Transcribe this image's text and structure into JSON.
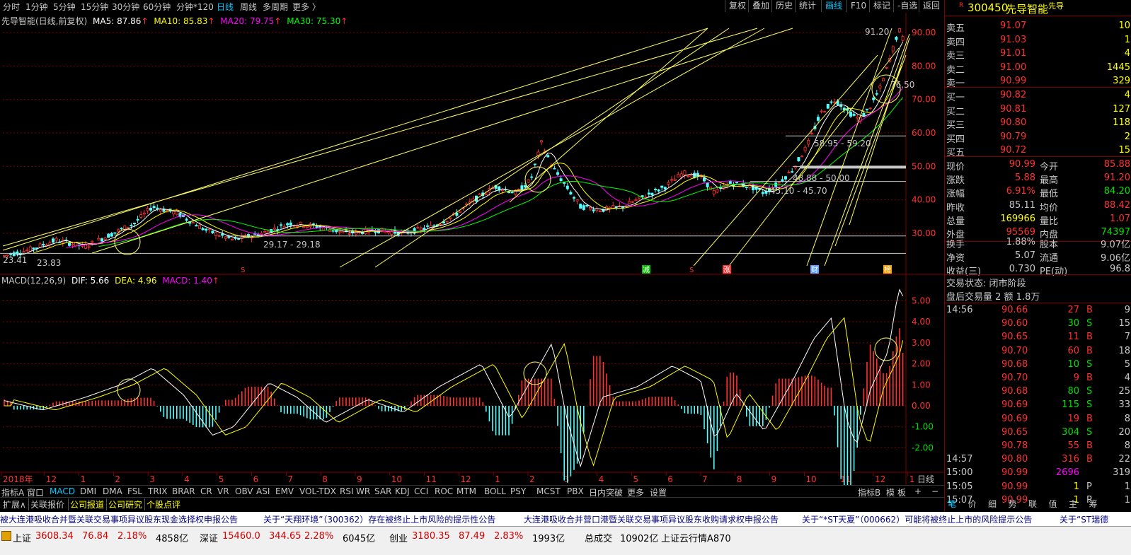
{
  "periods": [
    {
      "label": "分时",
      "active": false
    },
    {
      "label": "1分钟",
      "active": false
    },
    {
      "label": "5分钟",
      "active": false
    },
    {
      "label": "15分钟",
      "active": false
    },
    {
      "label": "30分钟",
      "active": false
    },
    {
      "label": "60分钟",
      "active": false
    },
    {
      "label": "分钟*120",
      "active": false
    },
    {
      "label": "日线",
      "active": true
    },
    {
      "label": "周线",
      "active": false
    },
    {
      "label": "多周期",
      "active": false
    },
    {
      "label": "更多 〉",
      "active": false
    }
  ],
  "toolbar_right": [
    {
      "label": "复权",
      "active": false
    },
    {
      "label": "叠加",
      "active": false
    },
    {
      "label": "历史",
      "active": false
    },
    {
      "label": "统计",
      "active": false
    },
    {
      "label": "画线",
      "active": true
    },
    {
      "label": "F10",
      "active": false
    },
    {
      "label": "标记",
      "active": false
    },
    {
      "label": "-自选",
      "active": false
    },
    {
      "label": "返回",
      "active": false
    }
  ],
  "main_legend": {
    "name": "先导智能(日线,前复权)",
    "ma5": "MA5: 87.86",
    "ma10": "MA10: 85.83",
    "ma20": "MA20: 79.75",
    "ma30": "MA30: 75.30",
    "arrow": "↑"
  },
  "macd_legend": {
    "name": "MACD(12,26,9)",
    "dif": "DIF: 5.66",
    "dea": "DEA: 4.96",
    "macd": "MACD: 1.40",
    "arrow": "↑"
  },
  "colors": {
    "up": "#ff3232",
    "down": "#54ffff",
    "ma5": "#ffffff",
    "ma10": "#ffff00",
    "ma20": "#ff00ff",
    "ma30": "#00ff00",
    "drawline": "#ffff66",
    "grid": "#800000",
    "accent": "#00c8ff"
  },
  "price_axis": [
    "90.00",
    "80.00",
    "70.00",
    "60.00",
    "50.00",
    "40.00",
    "30.00"
  ],
  "macd_axis": [
    "5.00",
    "4.00",
    "3.00",
    "2.00",
    "1.00",
    "0.00",
    "-1.00",
    "-2.00"
  ],
  "time_axis": [
    "2018年",
    "12",
    "1",
    "2",
    "3",
    "4",
    "5",
    "6",
    "7",
    "8",
    "9",
    "10",
    "11",
    "12",
    "1",
    "2",
    "3",
    "4",
    "5",
    "6",
    "7",
    "8",
    "9",
    "10",
    "11",
    "12",
    "1"
  ],
  "period_label": "日线",
  "annotations": {
    "high": "91.20",
    "sr1": "58.95 - 59.20",
    "sr2": "48.88 - 50.00",
    "sr3": "45.10 - 45.70",
    "sr4": "29.17 - 29.18",
    "low1": "23.83",
    "low2": "23.41",
    "right_tag": "76.50"
  },
  "markers": [
    "S",
    "减",
    "S",
    "涨",
    "财",
    "榜"
  ],
  "stock": {
    "code": "300450",
    "name": "先导智能",
    "tag": "先导",
    "flag": "R"
  },
  "asks": [
    {
      "label": "卖五",
      "price": "91.07",
      "vol": "10"
    },
    {
      "label": "卖四",
      "price": "91.03",
      "vol": "1"
    },
    {
      "label": "卖三",
      "price": "91.01",
      "vol": "4"
    },
    {
      "label": "卖二",
      "price": "91.00",
      "vol": "1445"
    },
    {
      "label": "卖一",
      "price": "90.99",
      "vol": "329"
    }
  ],
  "bids": [
    {
      "label": "买一",
      "price": "90.82",
      "vol": "4"
    },
    {
      "label": "买二",
      "price": "90.81",
      "vol": "127"
    },
    {
      "label": "买三",
      "price": "90.80",
      "vol": "118"
    },
    {
      "label": "买四",
      "price": "90.79",
      "vol": "2"
    },
    {
      "label": "买五",
      "price": "90.72",
      "vol": "15"
    }
  ],
  "quote": [
    {
      "l1": "现价",
      "v1": "90.99",
      "c1": "up",
      "l2": "今开",
      "v2": "85.88",
      "c2": "up"
    },
    {
      "l1": "涨跌",
      "v1": "5.88",
      "c1": "up",
      "l2": "最高",
      "v2": "91.20",
      "c2": "up"
    },
    {
      "l1": "涨幅",
      "v1": "6.91%",
      "c1": "up",
      "l2": "最低",
      "v2": "84.20",
      "c2": "down"
    },
    {
      "l1": "昨收",
      "v1": "85.11",
      "c1": "flat",
      "l2": "均价",
      "v2": "88.42",
      "c2": "up"
    },
    {
      "l1": "总量",
      "v1": "169966",
      "c1": "yellow",
      "l2": "量比",
      "v2": "1.07",
      "c2": "up"
    },
    {
      "l1": "外盘",
      "v1": "95569",
      "c1": "up",
      "l2": "内盘",
      "v2": "74397",
      "c2": "down"
    }
  ],
  "fund": [
    {
      "l1": "换手",
      "v1": "1.88%",
      "l2": "股本",
      "v2": "9.07亿"
    },
    {
      "l1": "净资",
      "v1": "5.07",
      "l2": "流通",
      "v2": "9.06亿"
    },
    {
      "l1": "收益(三)",
      "v1": "0.730",
      "l2": "PE(动)",
      "v2": "96.8"
    }
  ],
  "trade_state": "交易状态: 闭市阶段",
  "after_hours": "盘后交易量 2 额 1.8万",
  "ticks": [
    {
      "time": "14:56",
      "price": "90.66",
      "vol": "27",
      "bs": "B",
      "n": "9"
    },
    {
      "time": "",
      "price": "90.60",
      "vol": "30",
      "bs": "S",
      "n": "15"
    },
    {
      "time": "",
      "price": "90.65",
      "vol": "11",
      "bs": "B",
      "n": "7"
    },
    {
      "time": "",
      "price": "90.70",
      "vol": "60",
      "bs": "B",
      "n": "18"
    },
    {
      "time": "",
      "price": "90.68",
      "vol": "10",
      "bs": "S",
      "n": "5"
    },
    {
      "time": "",
      "price": "90.70",
      "vol": "9",
      "bs": "B",
      "n": "4"
    },
    {
      "time": "",
      "price": "90.68",
      "vol": "80",
      "bs": "S",
      "n": "25"
    },
    {
      "time": "",
      "price": "90.69",
      "vol": "115",
      "bs": "S",
      "n": "33"
    },
    {
      "time": "",
      "price": "90.69",
      "vol": "19",
      "bs": "B",
      "n": "8"
    },
    {
      "time": "",
      "price": "90.65",
      "vol": "304",
      "bs": "S",
      "n": "20"
    },
    {
      "time": "",
      "price": "90.78",
      "vol": "55",
      "bs": "B",
      "n": "8"
    },
    {
      "time": "14:57",
      "price": "90.80",
      "vol": "316",
      "bs": "B",
      "n": "22"
    },
    {
      "time": "15:00",
      "price": "90.99",
      "vol": "2696",
      "bs": "",
      "n": "319"
    },
    {
      "time": "15:05",
      "price": "90.99",
      "vol": "1",
      "bs": "P",
      "n": "1"
    },
    {
      "time": "15:07",
      "price": "90.99",
      "vol": "1",
      "bs": "P",
      "n": "1"
    }
  ],
  "right_tabs": [
    "笔",
    "价",
    "细",
    "势",
    "联",
    "值",
    "主",
    "筹"
  ],
  "indicator_tabs": [
    "指标A",
    "窗口",
    "MACD",
    "DMI",
    "DMA",
    "FSL",
    "TRIX",
    "BRAR",
    "CR",
    "VR",
    "OBV",
    "ASI",
    "EMV",
    "VOL-TDX",
    "RSI",
    "WR",
    "SAR",
    "KDJ",
    "CCI",
    "ROC",
    "MTM",
    "BOLL",
    "PSY",
    "MCST",
    "PBX",
    "日内突破",
    "更多",
    "设置"
  ],
  "indicator_right": [
    "指标B",
    "模",
    "板",
    "+",
    "−"
  ],
  "ext_tabs": [
    "扩展∧",
    "关联报价",
    "公司报道",
    "公司研究",
    "个股点评"
  ],
  "news": [
    "被大连港吸收合并暨关联交易事项异议股东现金选择权申报公告",
    "关于“天翔环境”（300362）存在被终止上市风险的提示性公告",
    "大连港吸收合并营口港暨关联交易事项异议股东收购请求权申报公告",
    "关于“*ST天夏”（000662）可能将被终止上市的风险提示公告",
    "关于“ST瑞德"
  ],
  "indices": [
    {
      "name": "上证",
      "value": "3608.34",
      "chg": "76.84",
      "pct": "2.18%",
      "amt": "4858亿"
    },
    {
      "name": "深证",
      "value": "15460.0",
      "chg": "344.65",
      "pct": "2.28%",
      "amt": "6045亿"
    },
    {
      "name": "创业",
      "value": "3180.35",
      "chg": "87.49",
      "pct": "2.83%",
      "amt": "1993亿"
    }
  ],
  "total_label": "总成交",
  "total_value": "10902亿",
  "server": "上证云行情A870"
}
